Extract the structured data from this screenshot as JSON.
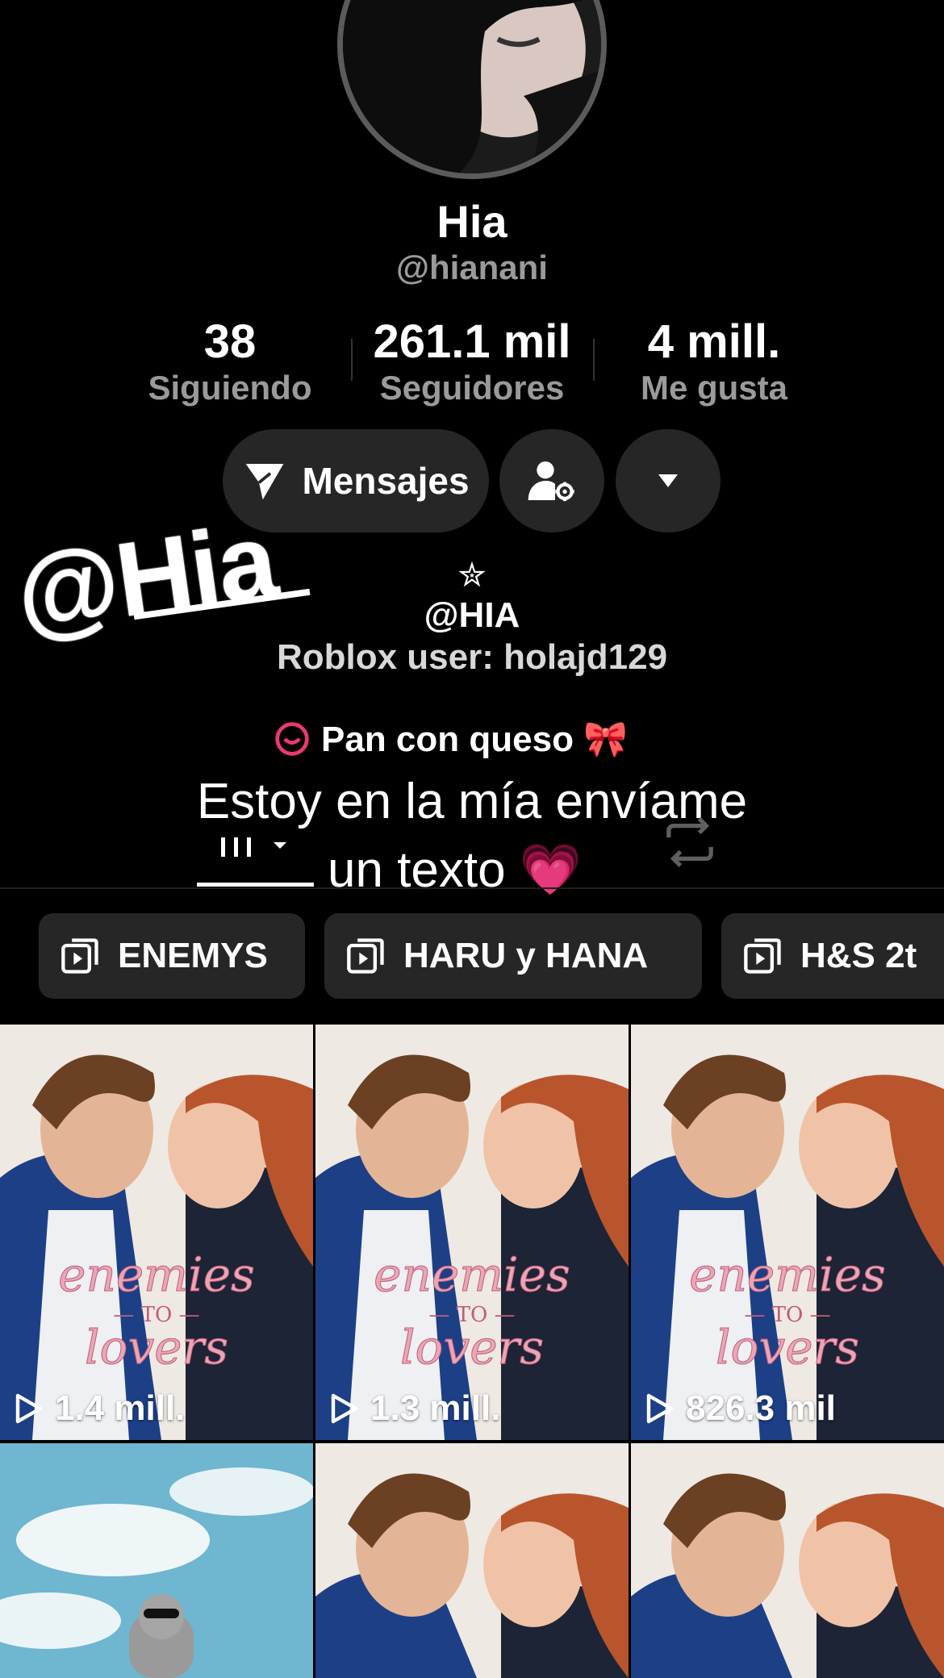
{
  "profile": {
    "name": "Hia",
    "handle": "@hianani"
  },
  "stats": [
    {
      "value": "38",
      "label": "Siguiendo"
    },
    {
      "value": "261.1 mil",
      "label": "Seguidores"
    },
    {
      "value": "4 mill.",
      "label": "Me gusta"
    }
  ],
  "actions": {
    "message_label": "Mensajes"
  },
  "bio": {
    "star": "✮",
    "line1": "@HIA",
    "line2": "Roblox user: holajd129",
    "line3": "Pan con queso 🎀"
  },
  "overlay": {
    "sticker": "@Hia",
    "caption_line1": "Estoy en la mía envíame",
    "caption_line2": "un texto 💗"
  },
  "playlists": [
    "ENEMYS",
    "HARU y HANA",
    "H&S 2t"
  ],
  "videos": [
    {
      "views": "1.4 mill."
    },
    {
      "views": "1.3 mill."
    },
    {
      "views": "826.3 mil"
    }
  ],
  "colors": {
    "background": "#000000",
    "button_bg": "#262626",
    "secondary_text": "#9a9a9a",
    "accent_pink": "#e83a6b"
  }
}
